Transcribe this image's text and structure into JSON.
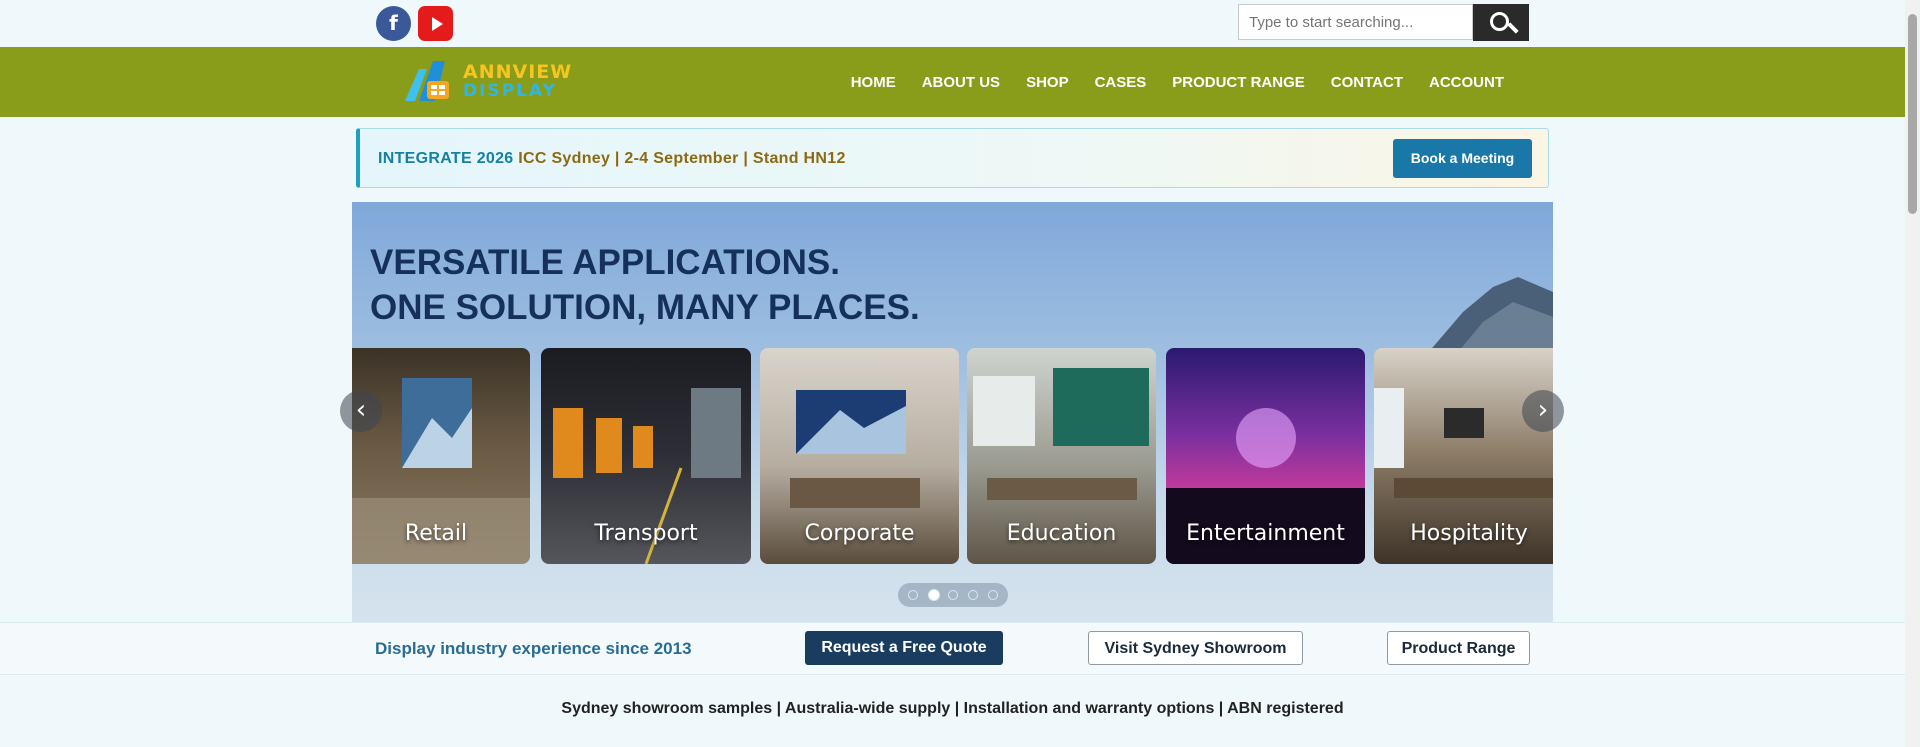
{
  "topbar": {
    "social": {
      "facebook_glyph": "f",
      "facebook_icon": "facebook-icon",
      "youtube_icon": "youtube-icon"
    },
    "search": {
      "placeholder": "Type to start searching...",
      "icon": "search-icon"
    }
  },
  "nav": {
    "logo": {
      "line1": "ANNVIEW",
      "line2": "DISPLAY"
    },
    "items": [
      "HOME",
      "ABOUT US",
      "SHOP",
      "CASES",
      "PRODUCT RANGE",
      "CONTACT",
      "ACCOUNT"
    ]
  },
  "event": {
    "title": "INTEGRATE 2026",
    "details": "ICC Sydney | 2-4 September | Stand HN12",
    "button": "Book a Meeting"
  },
  "hero": {
    "line1": "VERSATILE APPLICATIONS.",
    "line2": "ONE SOLUTION, MANY PLACES.",
    "tiles": [
      "Retail",
      "Transport",
      "Corporate",
      "Education",
      "Entertainment",
      "Hospitality"
    ],
    "prev_glyph": "‹",
    "next_glyph": "›",
    "slide_count": 5,
    "active_slide": 2
  },
  "cta": {
    "text": "Display industry experience since 2013",
    "quote": "Request a Free Quote",
    "showroom": "Visit Sydney Showroom",
    "range": "Product Range"
  },
  "trust_line": "Sydney showroom samples | Australia-wide supply | Installation and warranty options | ABN registered",
  "colors": {
    "nav_green": "#8a9d1a",
    "event_blue": "#1680a3",
    "event_gold": "#8d6a10",
    "cta_navy": "#1a3d5f",
    "page_bg": "#eff8fb"
  }
}
